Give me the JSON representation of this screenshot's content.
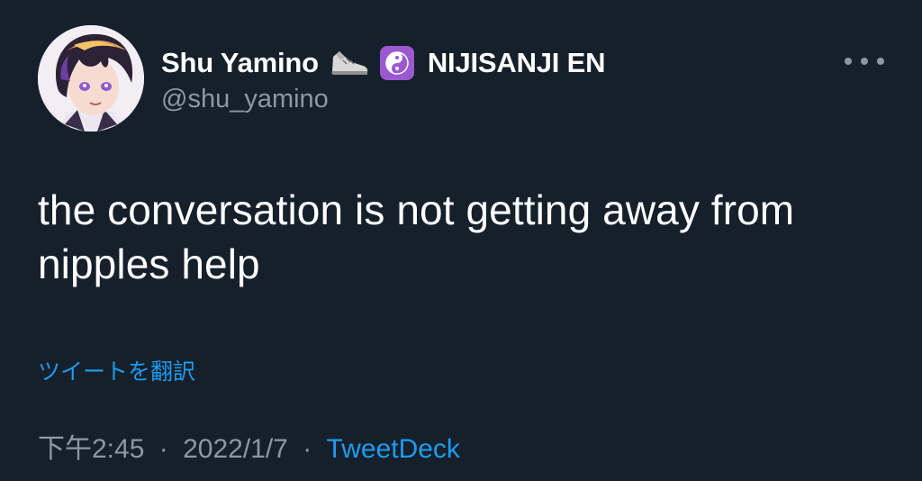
{
  "author": {
    "display_name": "Shu Yamino",
    "affiliation": "NIJISANJI EN",
    "handle": "@shu_yamino",
    "name_emojis": [
      "sneaker-icon",
      "yin-yang-icon"
    ]
  },
  "tweet": {
    "text": "the conversation is not getting away from nipples help",
    "translate_label": "ツイートを翻訳"
  },
  "meta": {
    "time": "下午2:45",
    "separator": "·",
    "date": "2022/1/7",
    "source": "TweetDeck"
  },
  "colors": {
    "background": "#15202b",
    "text_primary": "#ffffff",
    "text_secondary": "#8b98a5",
    "accent": "#1d9bf0",
    "emoji_purple": "#9b59d0"
  }
}
